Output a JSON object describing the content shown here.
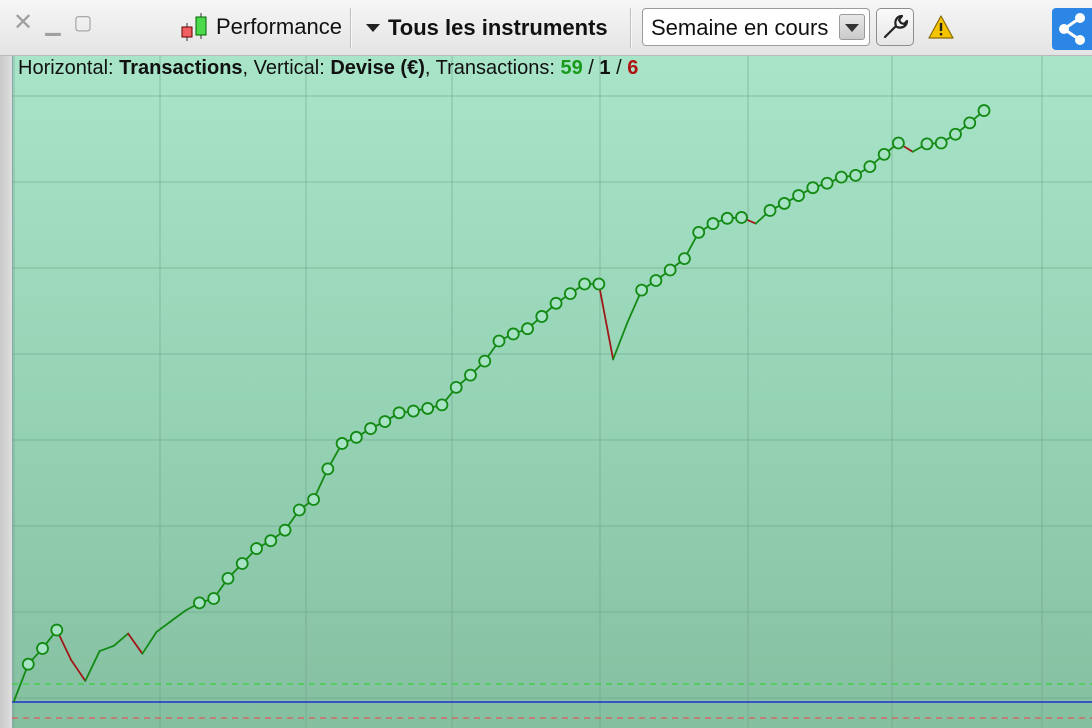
{
  "toolbar": {
    "close_icon": "close-icon",
    "minimize_icon": "minimize-icon",
    "maximize_icon": "maximize-icon",
    "performance_label": "Performance",
    "instruments_label": "Tous les instruments",
    "period_value": "Semaine en cours",
    "wrench_icon": "wrench-icon",
    "warning_icon": "warning-icon",
    "share_icon": "share-icon"
  },
  "info": {
    "horizontal_label": "Horizontal: ",
    "horizontal_value": "Transactions",
    "vertical_label": ", Vertical: ",
    "vertical_value": "Devise (€)",
    "transactions_label": ", Transactions: ",
    "wins": "59",
    "sep1": " / ",
    "neutral": "1",
    "sep2": " / ",
    "losses": "6"
  },
  "colors": {
    "win": "#1a9a1a",
    "loss": "#b01010",
    "line_up": "#138a13",
    "line_down": "#a01818",
    "baseline": "#1f2fd0",
    "dashed_top": "#3ccf3c",
    "dashed_bottom": "#e05a5a"
  },
  "chart_data": {
    "type": "line",
    "x": [
      0,
      1,
      2,
      3,
      4,
      5,
      6,
      7,
      8,
      9,
      10,
      11,
      12,
      13,
      14,
      15,
      16,
      17,
      18,
      19,
      20,
      21,
      22,
      23,
      24,
      25,
      26,
      27,
      28,
      29,
      30,
      31,
      32,
      33,
      34,
      35,
      36,
      37,
      38,
      39,
      40,
      41,
      42,
      43,
      44,
      45,
      46,
      47,
      48,
      49,
      50,
      51,
      52,
      53,
      54,
      55,
      56,
      57,
      58,
      59,
      60,
      61,
      62,
      63,
      64,
      65,
      66
    ],
    "y": [
      0,
      42,
      60,
      81,
      47,
      23,
      57,
      63,
      77,
      54,
      79,
      91,
      103,
      112,
      117,
      140,
      157,
      174,
      183,
      195,
      218,
      230,
      265,
      294,
      301,
      311,
      319,
      329,
      331,
      334,
      338,
      358,
      372,
      388,
      411,
      419,
      425,
      439,
      454,
      465,
      476,
      476,
      390,
      432,
      469,
      480,
      492,
      505,
      535,
      545,
      551,
      552,
      545,
      560,
      568,
      577,
      586,
      591,
      598,
      600,
      610,
      624,
      637,
      627,
      636,
      637,
      647,
      660,
      674
    ],
    "marker_y": [
      42,
      60,
      81,
      112,
      117,
      140,
      157,
      174,
      183,
      195,
      218,
      230,
      265,
      294,
      301,
      311,
      319,
      329,
      331,
      334,
      338,
      358,
      372,
      388,
      411,
      419,
      425,
      439,
      454,
      465,
      476,
      476,
      469,
      480,
      492,
      505,
      535,
      545,
      551,
      552,
      560,
      568,
      577,
      586,
      591,
      598,
      600,
      610,
      624,
      637,
      636,
      637,
      647,
      660,
      674
    ],
    "xlabel": "Transactions",
    "ylabel": "Devise (€)",
    "grid": true
  }
}
